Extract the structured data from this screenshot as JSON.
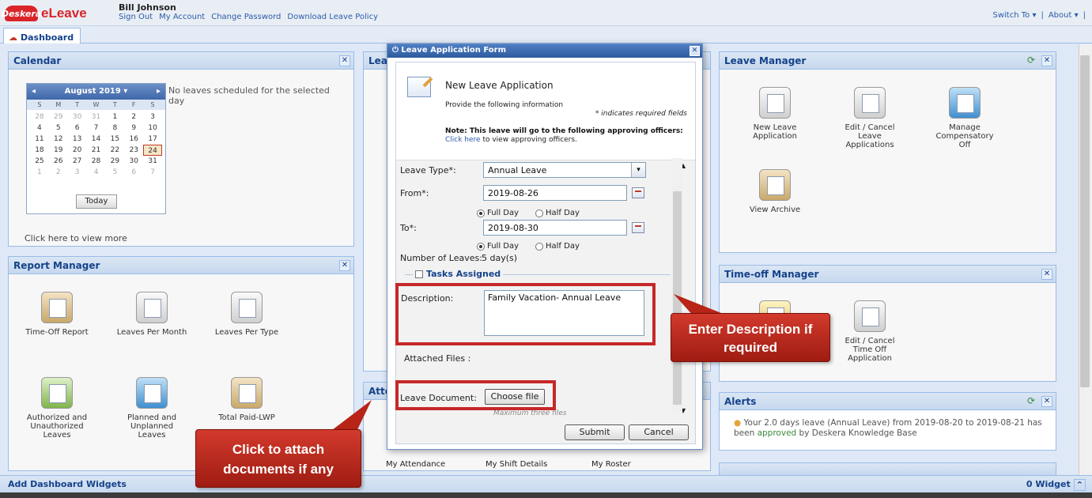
{
  "app": {
    "logo_badge": "Deskera",
    "logo_text": "eLeave",
    "user": "Bill Johnson"
  },
  "top_links": [
    "Sign Out",
    "My Account",
    "Change Password",
    "Download Leave Policy"
  ],
  "top_right": {
    "switch_to": "Switch To",
    "about": "About"
  },
  "tab": {
    "label": "Dashboard"
  },
  "calendar_panel": {
    "title": "Calendar",
    "message": "No leaves scheduled for the selected day",
    "month": "August 2019",
    "weekdays": [
      "S",
      "M",
      "T",
      "W",
      "T",
      "F",
      "S"
    ],
    "days": [
      "28",
      "29",
      "30",
      "31",
      "1",
      "2",
      "3",
      "4",
      "5",
      "6",
      "7",
      "8",
      "9",
      "10",
      "11",
      "12",
      "13",
      "14",
      "15",
      "16",
      "17",
      "18",
      "19",
      "20",
      "21",
      "22",
      "23",
      "24",
      "25",
      "26",
      "27",
      "28",
      "29",
      "30",
      "31",
      "1",
      "2",
      "3",
      "4",
      "5",
      "6",
      "7"
    ],
    "today_label": "Today",
    "view_more": "Click here to view more"
  },
  "report_panel": {
    "title": "Report Manager",
    "tiles": [
      "Time-Off Report",
      "Leaves Per Month",
      "Leaves Per Type",
      "Authorized and Unauthorized Leaves",
      "Planned and Unplanned Leaves",
      "Total Paid-LWP"
    ]
  },
  "middle_panels": {
    "top_title": "Lea",
    "bottom_title": "Atte",
    "tiles": [
      "My Attendance",
      "My Shift Details",
      "My Roster"
    ]
  },
  "leave_manager": {
    "title": "Leave Manager",
    "tiles": [
      "New Leave Application",
      "Edit / Cancel Leave Applications",
      "Manage Compensatory Off",
      "View Archive"
    ]
  },
  "timeoff_manager": {
    "title": "Time-off Manager",
    "tiles": [
      "Edit / Cancel Time Off Application"
    ]
  },
  "alerts": {
    "title": "Alerts",
    "text_prefix": "Your 2.0 days leave (Annual Leave) from 2019-08-20 to 2019-08-21 has been ",
    "text_status": "approved",
    "text_suffix": " by Deskera Knowledge Base"
  },
  "bottom_bar": {
    "add_widgets": "Add Dashboard Widgets",
    "widget_count": "0 Widget"
  },
  "modal": {
    "title": "Leave Application Form",
    "heading": "New Leave Application",
    "provide": "Provide the following information",
    "required_note": "* indicates required fields",
    "note_label": "Note: This leave will go to the following approving officers:",
    "click_here": "Click here",
    "click_here_rest": " to view approving officers.",
    "leave_type_label": "Leave Type*:",
    "leave_type_value": "Annual Leave",
    "from_label": "From*:",
    "from_value": "2019-08-26",
    "to_label": "To*:",
    "to_value": "2019-08-30",
    "full_day": "Full Day",
    "half_day": "Half Day",
    "num_leaves_label": "Number of Leaves:",
    "num_leaves_value": "5 day(s)",
    "tasks_label": "Tasks Assigned",
    "description_label": "Description:",
    "description_value": "Family Vacation- Annual Leave",
    "attached_label": "Attached Files :",
    "doc_label": "Leave Document:",
    "choose_file": "Choose file",
    "max_files": "Maximum three files",
    "submit": "Submit",
    "cancel": "Cancel"
  },
  "callouts": {
    "description": "Enter Description if required",
    "attach": "Click to attach documents if any"
  }
}
